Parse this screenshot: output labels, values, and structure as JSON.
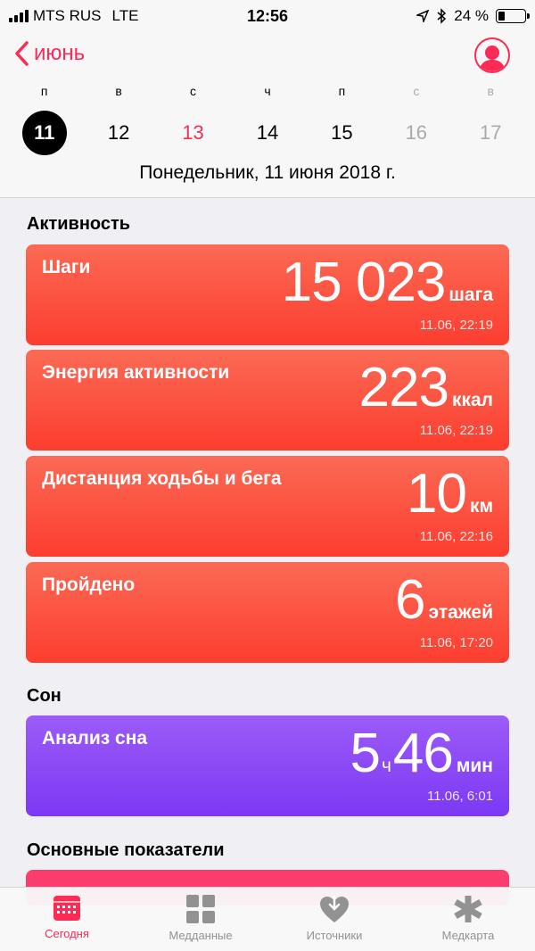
{
  "status_bar": {
    "carrier": "MTS RUS",
    "network": "LTE",
    "time": "12:56",
    "battery_percent": "24 %",
    "battery_level": 0.24
  },
  "header": {
    "back_label": "июнь",
    "week": [
      {
        "dow": "п",
        "day": "11",
        "state": "selected"
      },
      {
        "dow": "в",
        "day": "12",
        "state": "normal"
      },
      {
        "dow": "с",
        "day": "13",
        "state": "today"
      },
      {
        "dow": "ч",
        "day": "14",
        "state": "normal"
      },
      {
        "dow": "п",
        "day": "15",
        "state": "normal"
      },
      {
        "dow": "с",
        "day": "16",
        "state": "weekend"
      },
      {
        "dow": "в",
        "day": "17",
        "state": "weekend"
      }
    ],
    "date_label": "Понедельник, 11 июня 2018 г."
  },
  "sections": {
    "activity_title": "Активность",
    "sleep_title": "Сон",
    "vitals_title": "Основные показатели"
  },
  "cards": {
    "steps": {
      "title": "Шаги",
      "value": "15 023",
      "unit": "шага",
      "time": "11.06, 22:19"
    },
    "energy": {
      "title": "Энергия активности",
      "value": "223",
      "unit": "ккал",
      "time": "11.06, 22:19"
    },
    "distance": {
      "title": "Дистанция ходьбы и бега",
      "value": "10",
      "unit": "км",
      "time": "11.06, 22:16"
    },
    "floors": {
      "title": "Пройдено",
      "value": "6",
      "unit": "этажей",
      "time": "11.06, 17:20"
    },
    "sleep": {
      "title": "Анализ сна",
      "hours": "5",
      "hours_unit": "ч",
      "minutes": "46",
      "minutes_unit": "мин",
      "time": "11.06, 6:01"
    }
  },
  "tabbar": {
    "today": "Сегодня",
    "health_data": "Медданные",
    "sources": "Источники",
    "medical_id": "Медкарта"
  },
  "colors": {
    "accent": "#fb2b55",
    "activity": "#fc4a3c",
    "sleep": "#8a48f5"
  }
}
